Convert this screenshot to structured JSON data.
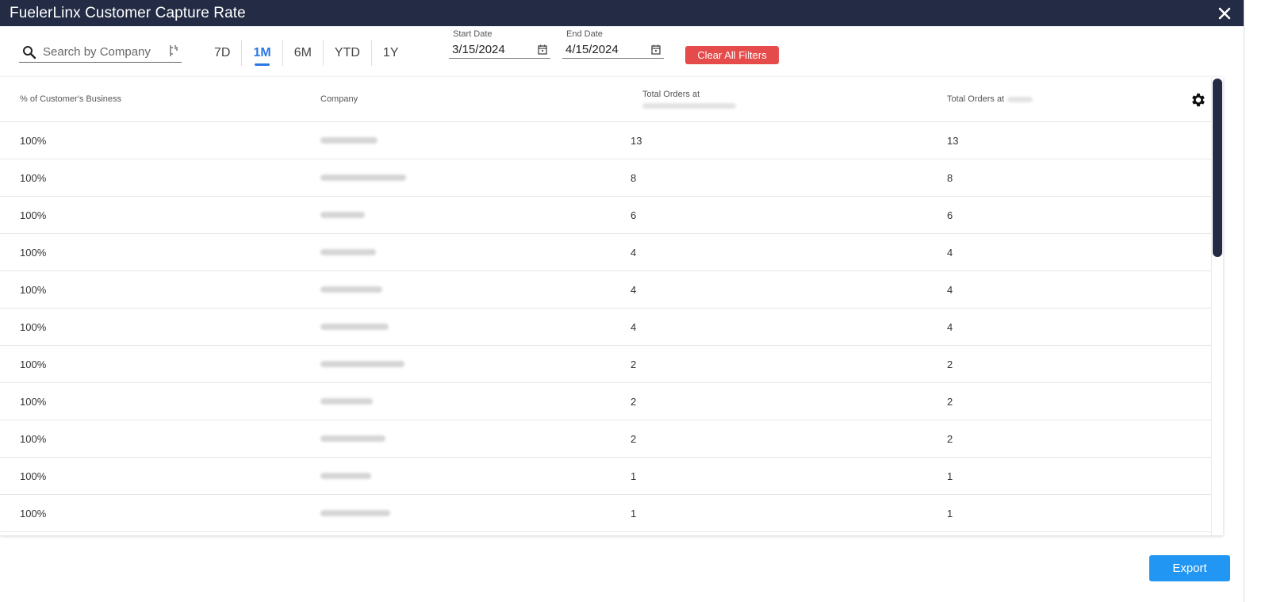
{
  "window": {
    "title": "FuelerLinx Customer Capture Rate"
  },
  "search": {
    "placeholder": "Search by Company"
  },
  "range_tabs": [
    {
      "label": "7D",
      "active": false
    },
    {
      "label": "1M",
      "active": true
    },
    {
      "label": "6M",
      "active": false
    },
    {
      "label": "YTD",
      "active": false
    },
    {
      "label": "1Y",
      "active": false
    }
  ],
  "start_date": {
    "label": "Start Date",
    "value": "3/15/2024"
  },
  "end_date": {
    "label": "End Date",
    "value": "4/15/2024"
  },
  "clear_filters_label": "Clear All Filters",
  "table": {
    "columns": [
      "% of Customer's Business",
      "Company",
      "Total Orders at",
      "Total Orders at"
    ],
    "rows": [
      {
        "pct": "100%",
        "company": "",
        "orders_a": "13",
        "orders_b": "13"
      },
      {
        "pct": "100%",
        "company": "",
        "orders_a": "8",
        "orders_b": "8"
      },
      {
        "pct": "100%",
        "company": "",
        "orders_a": "6",
        "orders_b": "6"
      },
      {
        "pct": "100%",
        "company": "",
        "orders_a": "4",
        "orders_b": "4"
      },
      {
        "pct": "100%",
        "company": "",
        "orders_a": "4",
        "orders_b": "4"
      },
      {
        "pct": "100%",
        "company": "",
        "orders_a": "4",
        "orders_b": "4"
      },
      {
        "pct": "100%",
        "company": "",
        "orders_a": "2",
        "orders_b": "2"
      },
      {
        "pct": "100%",
        "company": "",
        "orders_a": "2",
        "orders_b": "2"
      },
      {
        "pct": "100%",
        "company": "",
        "orders_a": "2",
        "orders_b": "2"
      },
      {
        "pct": "100%",
        "company": "",
        "orders_a": "1",
        "orders_b": "1"
      },
      {
        "pct": "100%",
        "company": "",
        "orders_a": "1",
        "orders_b": "1"
      }
    ]
  },
  "export_label": "Export",
  "colors": {
    "titlebar": "#232c44",
    "accent": "#2b78e4",
    "danger": "#e54b4b",
    "export": "#2196f3"
  }
}
